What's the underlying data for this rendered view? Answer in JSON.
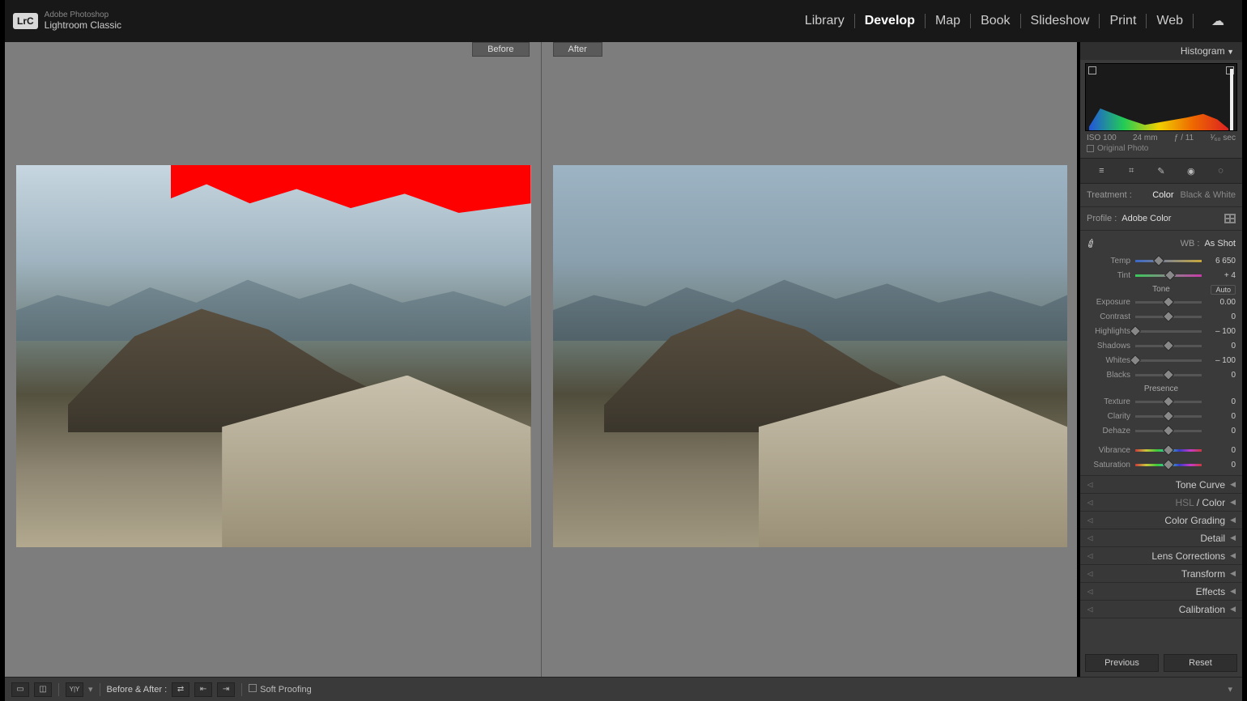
{
  "brand": {
    "badge": "LrC",
    "line1": "Adobe Photoshop",
    "line2": "Lightroom Classic"
  },
  "modules": {
    "library": "Library",
    "develop": "Develop",
    "map": "Map",
    "book": "Book",
    "slideshow": "Slideshow",
    "print": "Print",
    "web": "Web"
  },
  "compare": {
    "before": "Before",
    "after": "After"
  },
  "histogram": {
    "title": "Histogram",
    "iso": "ISO 100",
    "focal": "24 mm",
    "aperture": "ƒ / 11",
    "shutter": "¹⁄₆₀ sec",
    "original": "Original Photo"
  },
  "treatment": {
    "label": "Treatment :",
    "color": "Color",
    "bw": "Black & White"
  },
  "profile": {
    "label": "Profile :",
    "value": "Adobe Color"
  },
  "wb": {
    "label": "WB :",
    "value": "As Shot"
  },
  "tone_group": "Tone",
  "auto": "Auto",
  "presence_group": "Presence",
  "sliders": {
    "temp": {
      "label": "Temp",
      "value": "6 650"
    },
    "tint": {
      "label": "Tint",
      "value": "+ 4"
    },
    "exposure": {
      "label": "Exposure",
      "value": "0.00"
    },
    "contrast": {
      "label": "Contrast",
      "value": "0"
    },
    "highlights": {
      "label": "Highlights",
      "value": "– 100"
    },
    "shadows": {
      "label": "Shadows",
      "value": "0"
    },
    "whites": {
      "label": "Whites",
      "value": "– 100"
    },
    "blacks": {
      "label": "Blacks",
      "value": "0"
    },
    "texture": {
      "label": "Texture",
      "value": "0"
    },
    "clarity": {
      "label": "Clarity",
      "value": "0"
    },
    "dehaze": {
      "label": "Dehaze",
      "value": "0"
    },
    "vibrance": {
      "label": "Vibrance",
      "value": "0"
    },
    "saturation": {
      "label": "Saturation",
      "value": "0"
    }
  },
  "panels": {
    "tonecurve": "Tone Curve",
    "hsl_a": "HSL",
    "hsl_b": " / Color",
    "colorgrading": "Color Grading",
    "detail": "Detail",
    "lens": "Lens Corrections",
    "transform": "Transform",
    "effects": "Effects",
    "calibration": "Calibration"
  },
  "actions": {
    "previous": "Previous",
    "reset": "Reset"
  },
  "footer": {
    "before_after": "Before & After :",
    "softproof": "Soft Proofing"
  }
}
